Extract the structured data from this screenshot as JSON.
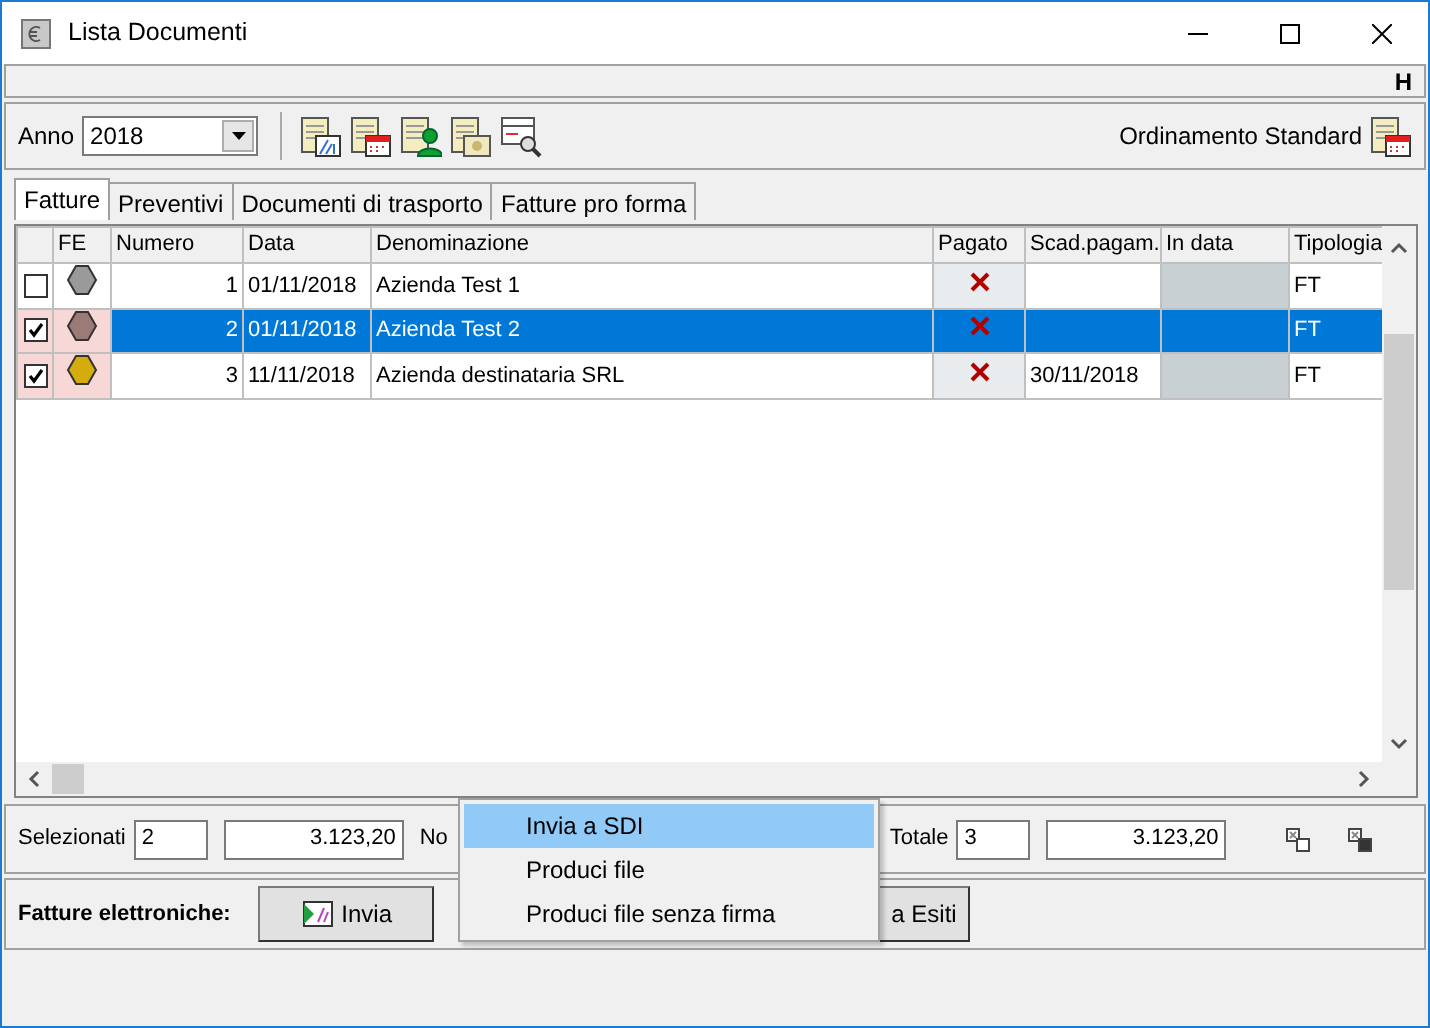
{
  "window": {
    "title": "Lista Documenti"
  },
  "strip": {
    "label": "H"
  },
  "toolbar": {
    "year_label": "Anno",
    "year": "2018",
    "sort_label": "Ordinamento Standard"
  },
  "tabs": [
    {
      "label": "Fatture",
      "selected": true
    },
    {
      "label": "Preventivi",
      "selected": false
    },
    {
      "label": "Documenti di trasporto",
      "selected": false
    },
    {
      "label": "Fatture pro forma",
      "selected": false
    }
  ],
  "table": {
    "columns": [
      "FE",
      "Numero",
      "Data",
      "Denominazione",
      "Pagato",
      "Scad.pagam.",
      "In data",
      "Tipologia"
    ],
    "rows": [
      {
        "checked": false,
        "selected": false,
        "color": "#9a9a9a",
        "numero": "1",
        "data": "01/11/2018",
        "denominazione": "Azienda Test 1",
        "paid": false,
        "tipologia": "FT"
      },
      {
        "checked": true,
        "selected": true,
        "color": "#9c7a78",
        "numero": "2",
        "data": "01/11/2018",
        "denominazione": "Azienda Test 2",
        "paid": false,
        "tipologia": "FT"
      },
      {
        "checked": true,
        "selected": false,
        "color": "#d4ac0d",
        "numero": "3",
        "data": "11/11/2018",
        "denominazione": "Azienda destinataria SRL",
        "paid": false,
        "scadenza": "30/11/2018",
        "tipologia": "FT"
      }
    ]
  },
  "summary": {
    "selected_label": "Selezionati",
    "selected_count": "2",
    "selected_total": "3.123,20",
    "partial_label": "No",
    "total_label": "Totale",
    "total_count": "3",
    "total_amount": "3.123,20"
  },
  "efatture": {
    "label": "Fatture elettroniche:",
    "buttons": [
      {
        "label": "Invia",
        "kind": "send"
      },
      {
        "label": "a Esiti",
        "kind": "plain"
      }
    ]
  },
  "menu": {
    "items": [
      {
        "label": "Invia a SDI",
        "selected": true
      },
      {
        "label": "Produci file",
        "selected": false
      },
      {
        "label": "Produci file senza firma",
        "selected": false
      }
    ]
  }
}
